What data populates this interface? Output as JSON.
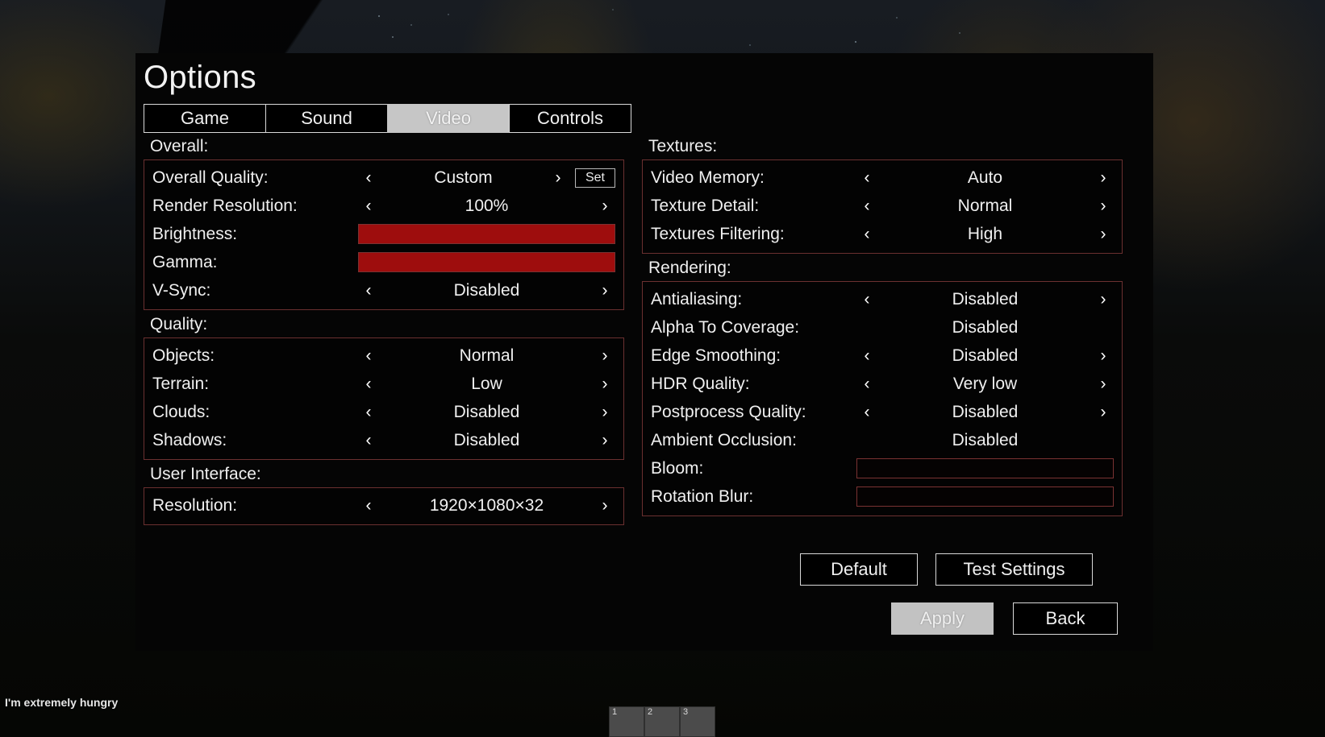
{
  "window": {
    "title": "Options"
  },
  "tabs": [
    {
      "label": "Game",
      "active": false
    },
    {
      "label": "Sound",
      "active": false
    },
    {
      "label": "Video",
      "active": true
    },
    {
      "label": "Controls",
      "active": false
    }
  ],
  "icons": {
    "arrow_left": "‹",
    "arrow_right": "›"
  },
  "colors": {
    "panel_border": "#6b3030",
    "slider_fill": "#9e0d0d",
    "slider_border": "#7a3232",
    "tab_active_bg": "#c6c6c6",
    "button_highlight_bg": "#c2c2c2",
    "dialog_bg": "#050505",
    "text": "#f0f0f0"
  },
  "sections": {
    "overall": {
      "label": "Overall:",
      "rows": [
        {
          "label": "Overall Quality:",
          "value": "Custom",
          "type": "selector",
          "arrows": true,
          "extra_button": "Set"
        },
        {
          "label": "Render Resolution:",
          "value": "100%",
          "type": "selector",
          "arrows": true
        },
        {
          "label": "Brightness:",
          "type": "slider",
          "fill_percent": 100
        },
        {
          "label": "Gamma:",
          "type": "slider",
          "fill_percent": 100
        },
        {
          "label": "V-Sync:",
          "value": "Disabled",
          "type": "selector",
          "arrows": true
        }
      ]
    },
    "quality": {
      "label": "Quality:",
      "rows": [
        {
          "label": "Objects:",
          "value": "Normal",
          "type": "selector",
          "arrows": true
        },
        {
          "label": "Terrain:",
          "value": "Low",
          "type": "selector",
          "arrows": true
        },
        {
          "label": "Clouds:",
          "value": "Disabled",
          "type": "selector",
          "arrows": true
        },
        {
          "label": "Shadows:",
          "value": "Disabled",
          "type": "selector",
          "arrows": true
        }
      ]
    },
    "user_interface": {
      "label": "User Interface:",
      "rows": [
        {
          "label": "Resolution:",
          "value": "1920×1080×32",
          "type": "selector",
          "arrows": true
        }
      ]
    },
    "textures": {
      "label": "Textures:",
      "rows": [
        {
          "label": "Video Memory:",
          "value": "Auto",
          "type": "selector",
          "arrows": true
        },
        {
          "label": "Texture Detail:",
          "value": "Normal",
          "type": "selector",
          "arrows": true
        },
        {
          "label": "Textures Filtering:",
          "value": "High",
          "type": "selector",
          "arrows": true
        }
      ]
    },
    "rendering": {
      "label": "Rendering:",
      "rows": [
        {
          "label": "Antialiasing:",
          "value": "Disabled",
          "type": "selector",
          "arrows": true
        },
        {
          "label": "Alpha To Coverage:",
          "value": "Disabled",
          "type": "selector",
          "arrows": false
        },
        {
          "label": "Edge Smoothing:",
          "value": "Disabled",
          "type": "selector",
          "arrows": true
        },
        {
          "label": "HDR Quality:",
          "value": "Very low",
          "type": "selector",
          "arrows": true
        },
        {
          "label": "Postprocess Quality:",
          "value": "Disabled",
          "type": "selector",
          "arrows": true
        },
        {
          "label": "Ambient Occlusion:",
          "value": "Disabled",
          "type": "selector",
          "arrows": false
        },
        {
          "label": "Bloom:",
          "type": "slider",
          "fill_percent": 0
        },
        {
          "label": "Rotation Blur:",
          "type": "slider",
          "fill_percent": 0
        }
      ]
    }
  },
  "buttons": {
    "default": {
      "label": "Default",
      "highlighted": false
    },
    "test_settings": {
      "label": "Test Settings",
      "highlighted": false
    },
    "apply": {
      "label": "Apply",
      "highlighted": true
    },
    "back": {
      "label": "Back",
      "highlighted": false
    }
  },
  "hud": {
    "status_text": "I'm extremely hungry",
    "hotbar_slots": [
      "1",
      "2",
      "3"
    ]
  }
}
